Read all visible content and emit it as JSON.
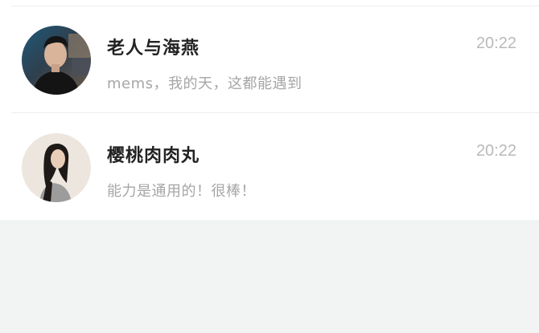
{
  "conversations": [
    {
      "name": "老人与海燕",
      "preview": "mems，我的天，这都能遇到",
      "time": "20:22",
      "avatar": "male-portrait-avatar"
    },
    {
      "name": "樱桃肉肉丸",
      "preview": "能力是通用的！很棒！",
      "time": "20:22",
      "avatar": "female-portrait-avatar"
    }
  ],
  "colors": {
    "name": "#222222",
    "preview": "#a6a6a6",
    "time": "#b9b9b9",
    "background": "#f2f3f3",
    "list_background": "#ffffff"
  }
}
